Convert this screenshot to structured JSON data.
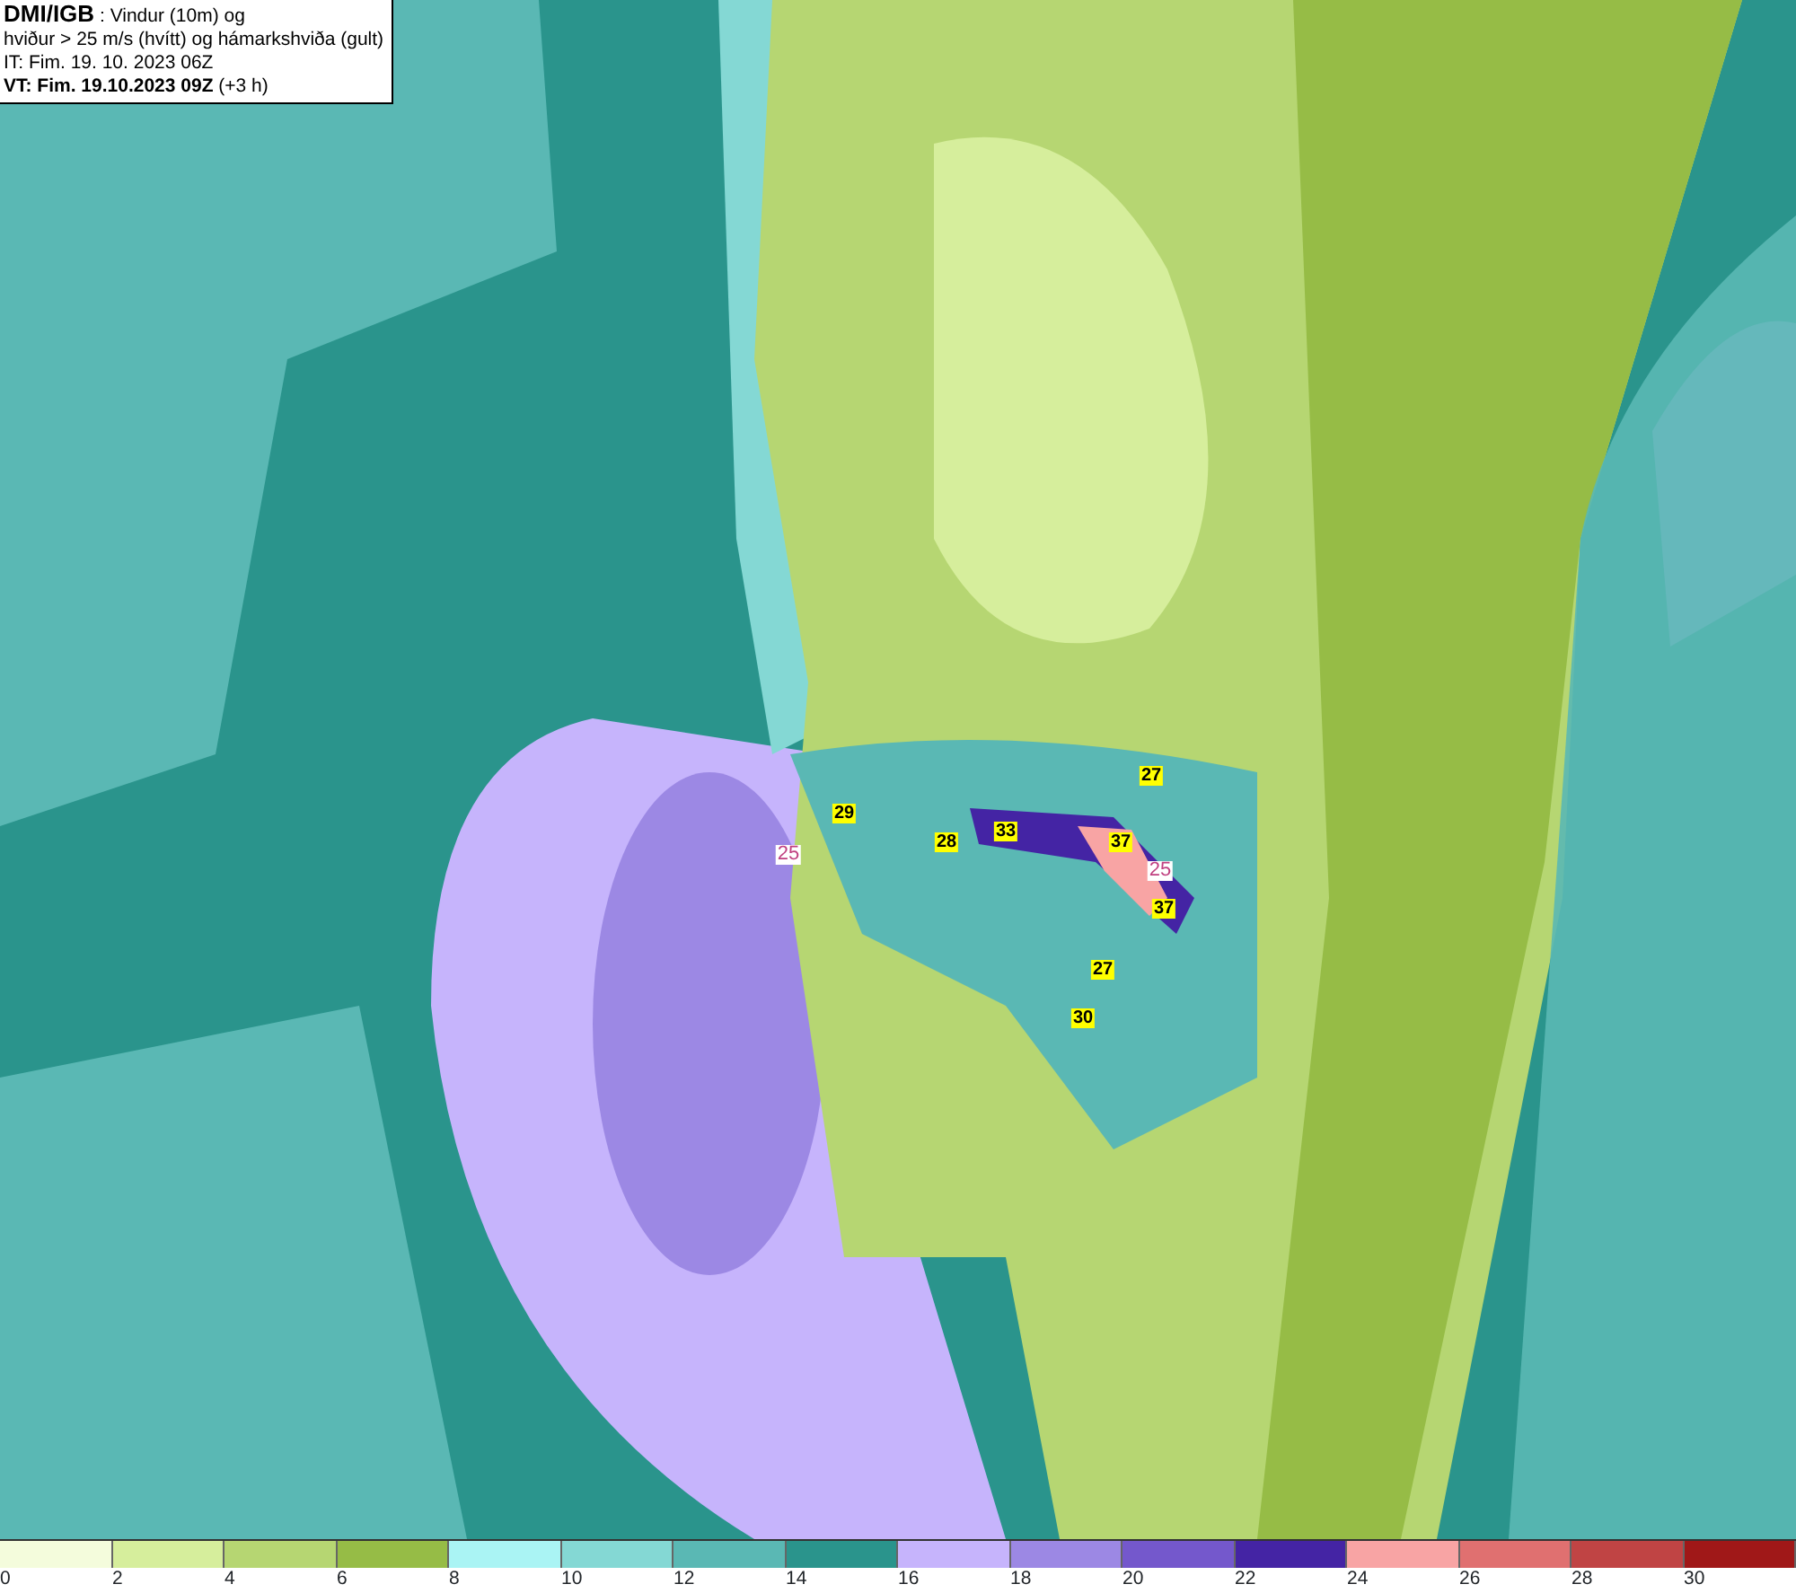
{
  "header": {
    "title": "DMI/IGB",
    "subtitle_1": ": Vindur (10m) og",
    "subtitle_2": "hviður > 25 m/s (hvítt) og hámarkshviða (gult)",
    "initial_time": "IT: Fim. 19. 10. 2023 06Z",
    "valid_time": "VT: Fim. 19.10.2023 09Z",
    "offset": "(+3 h)"
  },
  "map": {
    "labels": [
      {
        "kind": "contour",
        "text": "25"
      },
      {
        "kind": "gust",
        "text": "29"
      },
      {
        "kind": "gust",
        "text": "28"
      },
      {
        "kind": "gust",
        "text": "33"
      },
      {
        "kind": "gust",
        "text": "27"
      },
      {
        "kind": "gust",
        "text": "37"
      },
      {
        "kind": "contour",
        "text": "25"
      },
      {
        "kind": "gust",
        "text": "37"
      },
      {
        "kind": "gust",
        "text": "27"
      },
      {
        "kind": "gust",
        "text": "30"
      }
    ]
  },
  "legend": {
    "swatches": [
      {
        "color": "#f4fcdc"
      },
      {
        "color": "#d6ee9c"
      },
      {
        "color": "#b6d672"
      },
      {
        "color": "#96bc46"
      },
      {
        "color": "#aaf4f4"
      },
      {
        "color": "#84d8d4"
      },
      {
        "color": "#5ab8b4"
      },
      {
        "color": "#2a948c"
      },
      {
        "color": "#c6b4fc"
      },
      {
        "color": "#9c88e4"
      },
      {
        "color": "#7458cc"
      },
      {
        "color": "#4424a4"
      },
      {
        "color": "#f8a4a4"
      },
      {
        "color": "#e07070"
      },
      {
        "color": "#c04444"
      },
      {
        "color": "#a01818"
      }
    ],
    "ticks": [
      "0",
      "2",
      "4",
      "6",
      "8",
      "10",
      "12",
      "14",
      "16",
      "18",
      "20",
      "22",
      "24",
      "26",
      "28",
      "30"
    ]
  }
}
